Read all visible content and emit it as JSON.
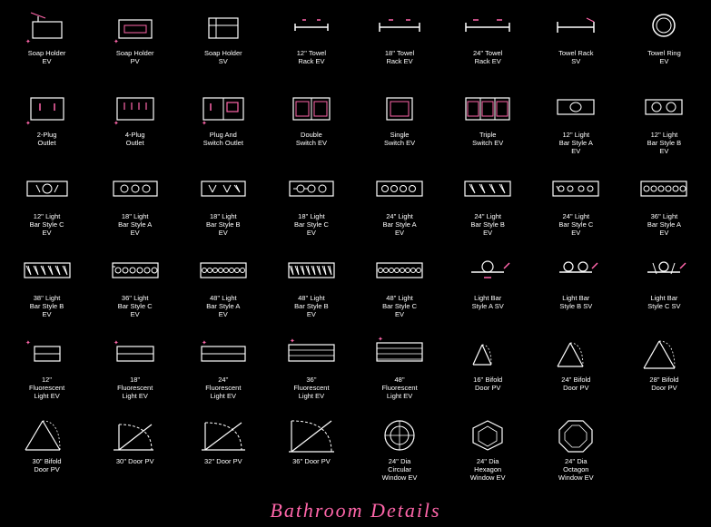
{
  "title": "Bathroom  Details",
  "rows": [
    {
      "cells": [
        {
          "label": "Soap  Holder\nEV",
          "icon": "soap_holder_ev"
        },
        {
          "label": "Soap  Holder\nPV",
          "icon": "soap_holder_pv"
        },
        {
          "label": "Soap  Holder\nSV",
          "icon": "soap_holder_sv"
        },
        {
          "label": "12'' Towel\nRack EV",
          "icon": "towel_rack_12"
        },
        {
          "label": "18'' Towel\nRack EV",
          "icon": "towel_rack_18"
        },
        {
          "label": "24'' Towel\nRack EV",
          "icon": "towel_rack_24"
        },
        {
          "label": "Towel  Rack\nSV",
          "icon": "towel_rack_sv"
        },
        {
          "label": "Towel  Ring\nEV",
          "icon": "towel_ring_ev"
        }
      ]
    },
    {
      "cells": [
        {
          "label": "2-Plug\nOutlet",
          "icon": "plug2"
        },
        {
          "label": "4-Plug\nOutlet",
          "icon": "plug4"
        },
        {
          "label": "Plug And\nSwitch Outlet",
          "icon": "plug_switch"
        },
        {
          "label": "Double\nSwitch EV",
          "icon": "switch_double"
        },
        {
          "label": "Single\nSwitch EV",
          "icon": "switch_single"
        },
        {
          "label": "Triple\nSwitch EV",
          "icon": "switch_triple"
        },
        {
          "label": "12'' Light\nBar Style A\nEV",
          "icon": "lightbar_12a"
        },
        {
          "label": "12'' Light\nBar Style B\nEV",
          "icon": "lightbar_12b"
        }
      ]
    },
    {
      "cells": [
        {
          "label": "12'' Light\nBar Style C\nEV",
          "icon": "lightbar_12c"
        },
        {
          "label": "18'' Light\nBar Style A\nEV",
          "icon": "lightbar_18a"
        },
        {
          "label": "18'' Light\nBar Style B\nEV",
          "icon": "lightbar_18b"
        },
        {
          "label": "18'' Light\nBar Style C\nEV",
          "icon": "lightbar_18c"
        },
        {
          "label": "24'' Light\nBar Style A\nEV",
          "icon": "lightbar_24a"
        },
        {
          "label": "24'' Light\nBar Style B\nEV",
          "icon": "lightbar_24b"
        },
        {
          "label": "24'' Light\nBar Style C\nEV",
          "icon": "lightbar_24c"
        },
        {
          "label": "36'' Light\nBar Style A\nEV",
          "icon": "lightbar_36a"
        }
      ]
    },
    {
      "cells": [
        {
          "label": "38'' Light\nBar Style B\nEV",
          "icon": "lightbar_38b"
        },
        {
          "label": "36'' Light\nBar Style C\nEV",
          "icon": "lightbar_36c"
        },
        {
          "label": "48'' Light\nBar Style A\nEV",
          "icon": "lightbar_48a"
        },
        {
          "label": "48'' Light\nBar Style B\nEV",
          "icon": "lightbar_48b"
        },
        {
          "label": "48'' Light\nBar Style C\nEV",
          "icon": "lightbar_48c"
        },
        {
          "label": "Light Bar\nStyle A SV",
          "icon": "lightbar_asv"
        },
        {
          "label": "Light Bar\nStyle B SV",
          "icon": "lightbar_bsv"
        },
        {
          "label": "Light Bar\nStyle C SV",
          "icon": "lightbar_csv"
        }
      ]
    },
    {
      "cells": [
        {
          "label": "12''\nFluorescent\nLight EV",
          "icon": "fluor_12"
        },
        {
          "label": "18''\nFluorescent\nLight EV",
          "icon": "fluor_18"
        },
        {
          "label": "24''\nFluorescent\nLight EV",
          "icon": "fluor_24"
        },
        {
          "label": "36''\nFluorescent\nLight EV",
          "icon": "fluor_36"
        },
        {
          "label": "48''\nFluorescent\nLight EV",
          "icon": "fluor_48"
        },
        {
          "label": "16'' Bifold\nDoor PV",
          "icon": "bifold_16"
        },
        {
          "label": "24'' Bifold\nDoor PV",
          "icon": "bifold_24"
        },
        {
          "label": "28'' Bifold\nDoor PV",
          "icon": "bifold_28"
        }
      ]
    },
    {
      "cells": [
        {
          "label": "30'' Bifold\nDoor PV",
          "icon": "bifold_30"
        },
        {
          "label": "30'' Door PV",
          "icon": "door_30"
        },
        {
          "label": "32'' Door PV",
          "icon": "door_32"
        },
        {
          "label": "36'' Door PV",
          "icon": "door_36"
        },
        {
          "label": "24'' Dia\nCircular\nWindow EV",
          "icon": "window_circle"
        },
        {
          "label": "24'' Dia\nHexagon\nWindow EV",
          "icon": "window_hex"
        },
        {
          "label": "24'' Dia\nOctagon\nWindow EV",
          "icon": "window_oct"
        },
        {
          "label": "",
          "icon": "empty"
        }
      ]
    }
  ]
}
